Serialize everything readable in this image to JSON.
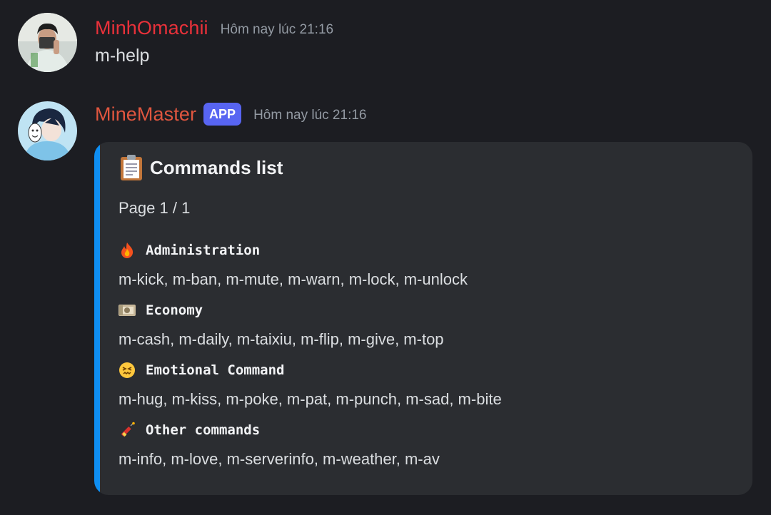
{
  "messages": [
    {
      "username": "MinhOmachii",
      "username_color": "#e8313a",
      "timestamp": "Hôm nay lúc 21:16",
      "content": "m-help"
    },
    {
      "username": "MineMaster",
      "username_color": "#e0563f",
      "badge": "APP",
      "badge_color": "#5865f2",
      "timestamp": "Hôm nay lúc 21:16",
      "embed": {
        "accent_color": "#0e8ef2",
        "title_icon": "clipboard-icon",
        "title": "Commands list",
        "page": "Page 1 / 1",
        "sections": [
          {
            "icon": "fire-icon",
            "name": "Administration",
            "commands": "m-kick, m-ban, m-mute, m-warn, m-lock, m-unlock"
          },
          {
            "icon": "money-icon",
            "name": "Economy",
            "commands": "m-cash, m-daily, m-taixiu, m-flip, m-give, m-top"
          },
          {
            "icon": "confounded-face-icon",
            "name": "Emotional Command",
            "commands": "m-hug, m-kiss, m-poke, m-pat, m-punch, m-sad, m-bite"
          },
          {
            "icon": "firecracker-icon",
            "name": "Other commands",
            "commands": "m-info, m-love, m-serverinfo, m-weather, m-av"
          }
        ]
      }
    }
  ]
}
